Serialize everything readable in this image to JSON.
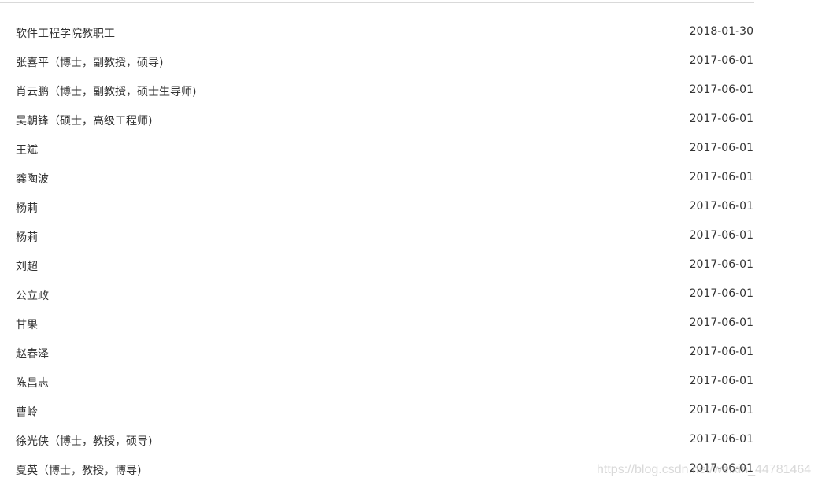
{
  "items": [
    {
      "title": "软件工程学院教职工",
      "date": "2018-01-30"
    },
    {
      "title": "张喜平（博士，副教授，硕导)",
      "date": "2017-06-01"
    },
    {
      "title": "肖云鹏（博士，副教授，硕士生导师)",
      "date": "2017-06-01"
    },
    {
      "title": "吴朝锋（硕士，高级工程师)",
      "date": "2017-06-01"
    },
    {
      "title": "王斌",
      "date": "2017-06-01"
    },
    {
      "title": "龚陶波",
      "date": "2017-06-01"
    },
    {
      "title": "杨莉",
      "date": "2017-06-01"
    },
    {
      "title": "杨莉",
      "date": "2017-06-01"
    },
    {
      "title": "刘超",
      "date": "2017-06-01"
    },
    {
      "title": "公立政",
      "date": "2017-06-01"
    },
    {
      "title": "甘果",
      "date": "2017-06-01"
    },
    {
      "title": "赵春泽",
      "date": "2017-06-01"
    },
    {
      "title": "陈昌志",
      "date": "2017-06-01"
    },
    {
      "title": "曹岭",
      "date": "2017-06-01"
    },
    {
      "title": "徐光侠（博士，教授，硕导)",
      "date": "2017-06-01"
    },
    {
      "title": "夏英（博士，教授，博导)",
      "date": "2017-06-01"
    }
  ],
  "watermark": "https://blog.csdn.net/weixin_44781464"
}
